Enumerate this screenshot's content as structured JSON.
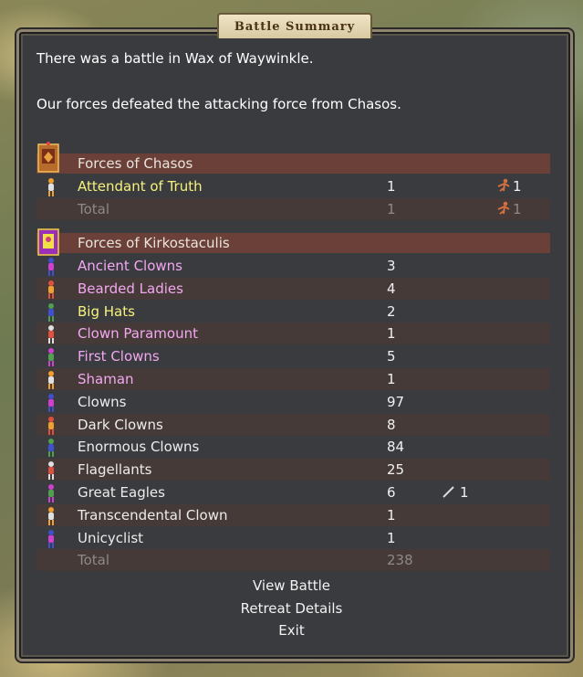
{
  "dialog": {
    "title": "Battle Summary"
  },
  "intro": {
    "line1": "There was a battle in Wax of Waywinkle.",
    "line2": "Our forces defeated the attacking force from Chasos."
  },
  "attacker": {
    "header": "Forces of Chasos",
    "units": [
      {
        "name": "Attendant of Truth",
        "count": "1",
        "losses": "1",
        "color": "#f6f27c"
      }
    ],
    "total": {
      "label": "Total",
      "count": "1",
      "losses": "1"
    }
  },
  "defender": {
    "header": "Forces of Kirkostaculis",
    "units": [
      {
        "name": "Ancient Clowns",
        "count": "3",
        "color": "#f2a8f0"
      },
      {
        "name": "Bearded Ladies",
        "count": "4",
        "color": "#f2a8f0"
      },
      {
        "name": "Big Hats",
        "count": "2",
        "color": "#f6f27c"
      },
      {
        "name": "Clown Paramount",
        "count": "1",
        "color": "#f2a8f0"
      },
      {
        "name": "First Clowns",
        "count": "5",
        "color": "#f2a8f0"
      },
      {
        "name": "Shaman",
        "count": "1",
        "color": "#f2a8f0"
      },
      {
        "name": "Clowns",
        "count": "97",
        "color": "#ececec"
      },
      {
        "name": "Dark Clowns",
        "count": "8",
        "color": "#ececec"
      },
      {
        "name": "Enormous Clowns",
        "count": "84",
        "color": "#ececec"
      },
      {
        "name": "Flagellants",
        "count": "25",
        "color": "#ececec"
      },
      {
        "name": "Great Eagles",
        "count": "6",
        "kills": "1",
        "color": "#ececec"
      },
      {
        "name": "Transcendental Clown",
        "count": "1",
        "color": "#ececec"
      },
      {
        "name": "Unicyclist",
        "count": "1",
        "color": "#ececec"
      }
    ],
    "total": {
      "label": "Total",
      "count": "238"
    }
  },
  "actions": {
    "view_battle": "View Battle",
    "retreat_details": "Retreat Details",
    "exit": "Exit"
  }
}
